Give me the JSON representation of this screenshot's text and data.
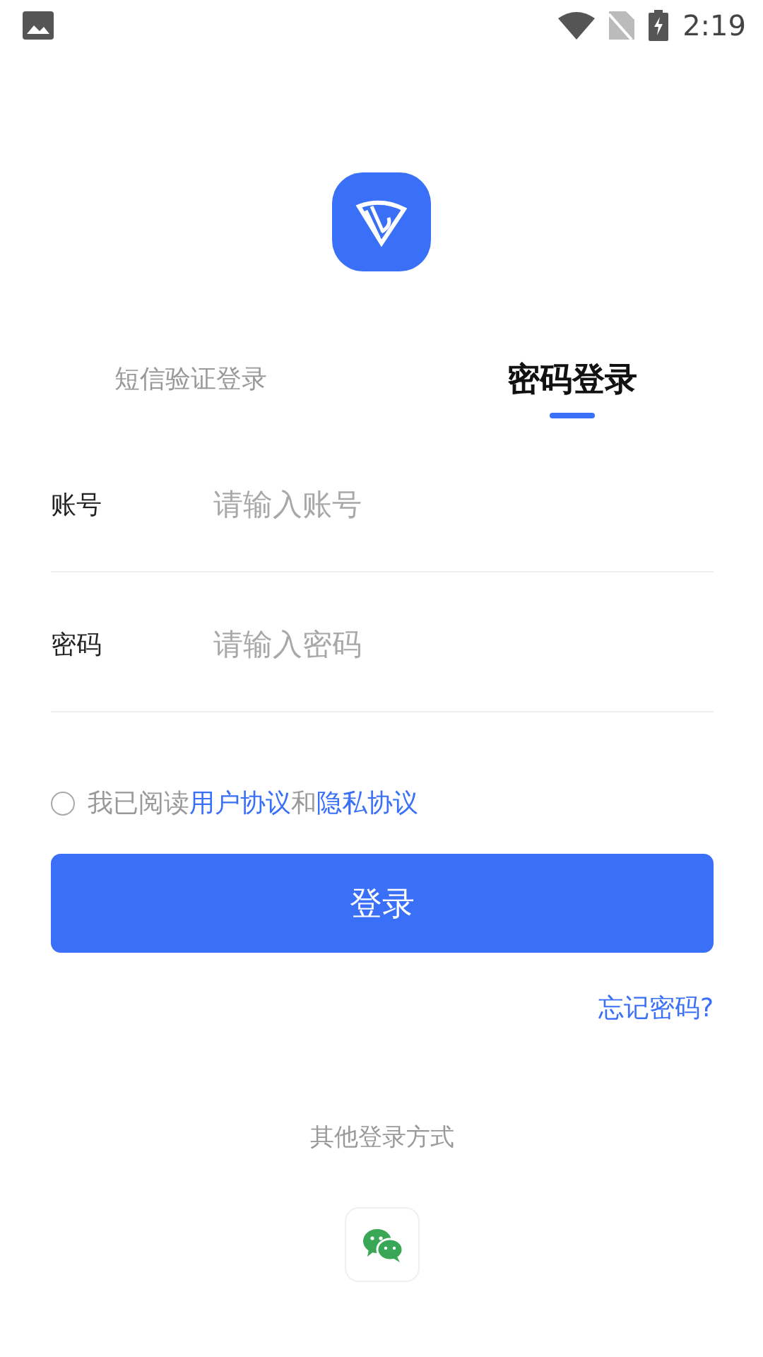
{
  "status_bar": {
    "time": "2:19"
  },
  "tabs": [
    {
      "label": "短信验证登录",
      "selected": false
    },
    {
      "label": "密码登录",
      "selected": true
    }
  ],
  "fields": [
    {
      "label": "账号",
      "placeholder": "请输入账号"
    },
    {
      "label": "密码",
      "placeholder": "请输入密码"
    }
  ],
  "agreement": {
    "checked": false,
    "prefix": "我已阅读",
    "link_1": "用户协议",
    "joiner": "和",
    "link_2": "隐私协议"
  },
  "login_button": "登录",
  "forgot_password": "忘记密码?",
  "other_login": "其他登录方式"
}
